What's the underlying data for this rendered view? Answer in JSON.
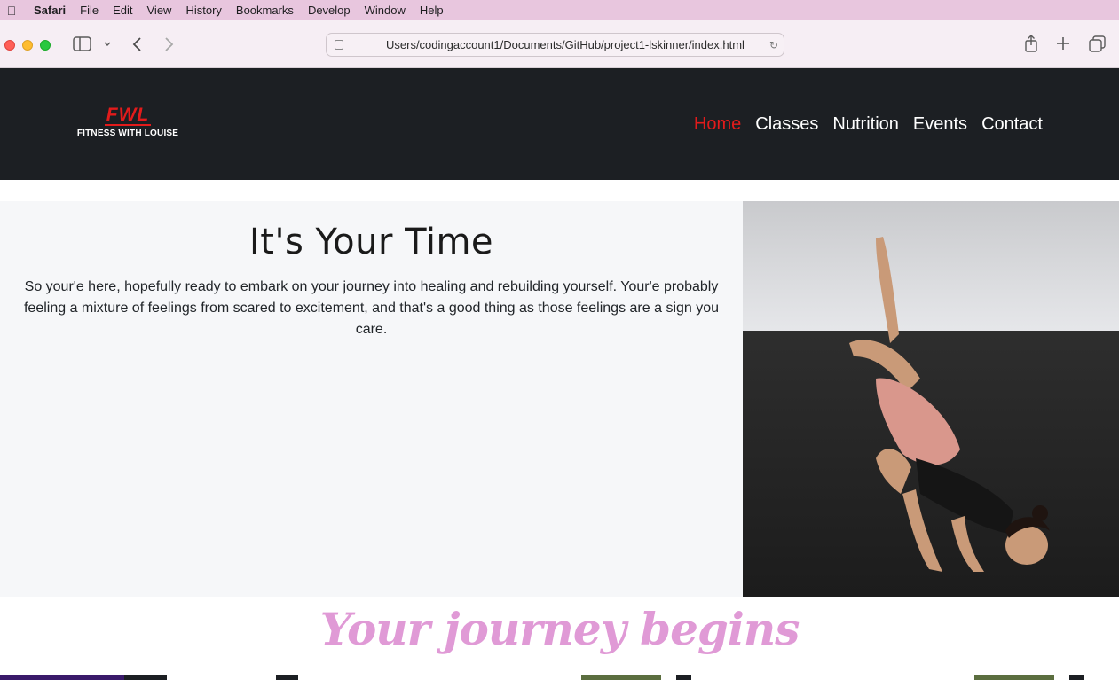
{
  "menubar": {
    "app": "Safari",
    "items": [
      "File",
      "Edit",
      "View",
      "History",
      "Bookmarks",
      "Develop",
      "Window",
      "Help"
    ]
  },
  "browser": {
    "url": "Users/codingaccount1/Documents/GitHub/project1-lskinner/index.html",
    "icons": [
      "sidebar-icon",
      "chevron-down-icon",
      "back-icon",
      "forward-icon",
      "share-icon",
      "new-tab-icon",
      "tab-overview-icon",
      "reload-icon"
    ]
  },
  "site": {
    "logo_mark": "FWL",
    "logo_text": "FITNESS WITH LOUISE",
    "nav": [
      "Home",
      "Classes",
      "Nutrition",
      "Events",
      "Contact"
    ],
    "active_color": "#e31b1b",
    "hero_title": "It's Your Time",
    "hero_text": "So your'e here, hopefully ready to embark on your journey into healing and rebuilding yourself. Your'e probably feeling a mixture of feelings from scared to excitement, and that's a good thing as those feelings are a sign you care.",
    "journey_heading": "Your journey begins",
    "accent_color": "#e09ad6"
  }
}
